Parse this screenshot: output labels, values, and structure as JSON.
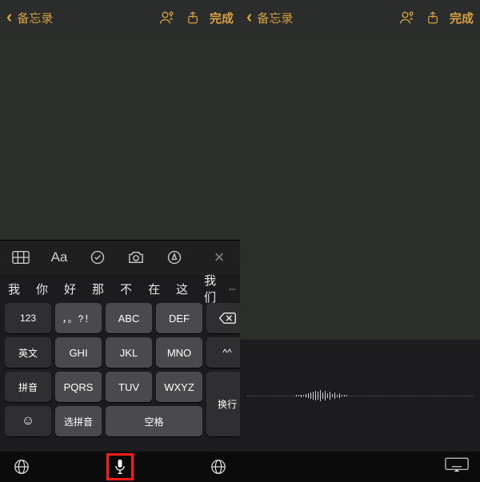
{
  "nav": {
    "back_label": "备忘录",
    "done_label": "完成"
  },
  "fmt": {
    "table": "table-icon",
    "text": "Aa",
    "check": "✓",
    "camera": "camera",
    "marker": "marker",
    "close": "×"
  },
  "candidates": [
    "我",
    "你",
    "好",
    "那",
    "不",
    "在",
    "这",
    "我们"
  ],
  "keys": {
    "r1": [
      "123",
      "，。?！",
      "ABC",
      "DEF"
    ],
    "r1_side": "⌫",
    "r2": [
      "英文",
      "GHI",
      "JKL",
      "MNO"
    ],
    "r2_side": "^^",
    "r3": [
      "拼音",
      "PQRS",
      "TUV",
      "WXYZ"
    ],
    "r34_side": "换行",
    "r4_a": "☺",
    "r4_b": "选拼音",
    "r4_c": "空格"
  }
}
